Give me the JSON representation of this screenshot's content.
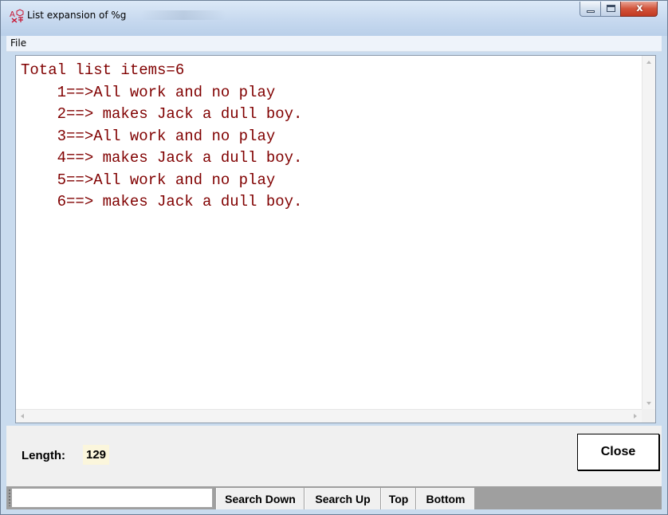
{
  "window": {
    "title": "List expansion of %g",
    "controls": {
      "close_symbol": "x"
    }
  },
  "menu": {
    "file": "File"
  },
  "content": {
    "total_line": "Total list items=6",
    "items": [
      "    1==>All work and no play",
      "    2==> makes Jack a dull boy.",
      "    3==>All work and no play",
      "    4==> makes Jack a dull boy.",
      "    5==>All work and no play",
      "    6==> makes Jack a dull boy."
    ],
    "text_color": "#800000"
  },
  "footer": {
    "length_label": "Length:",
    "length_value": "129",
    "close_label": "Close"
  },
  "searchbar": {
    "search_value": "",
    "search_down": "Search Down",
    "search_up": "Search Up",
    "top": "Top",
    "bottom": "Bottom"
  },
  "icons": {
    "app": "app-font-icon",
    "minimize": "minimize-icon",
    "maximize": "maximize-icon",
    "close": "close-icon"
  }
}
